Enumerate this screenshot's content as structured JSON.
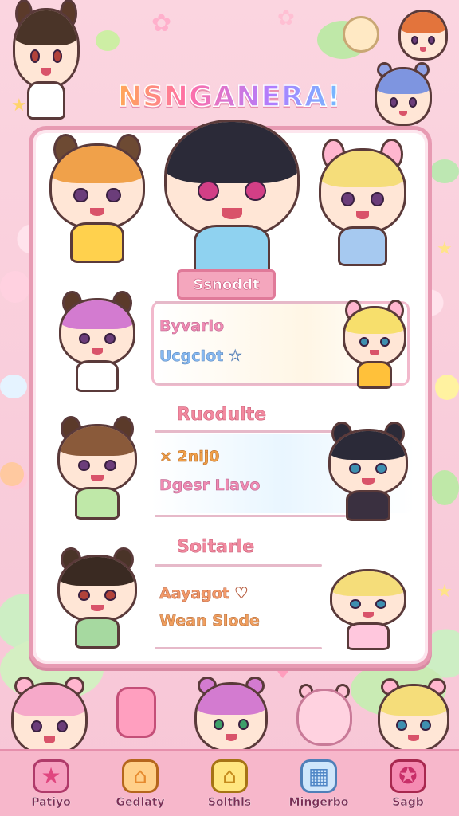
{
  "app": {
    "title": "NSNGANERA!"
  },
  "panel": {
    "feature_label": "Ssnoddt",
    "rows": [
      {
        "line1": "Byvarlo",
        "line2": "Ucgclot"
      },
      {
        "section": "Ruodulte",
        "line1": "× 2nij0",
        "line2": "Dgesr Llavo"
      },
      {
        "section": "Soitarle",
        "line1": "Aayagot",
        "line2": "Wean Slode"
      }
    ]
  },
  "nav": [
    {
      "label": "Patiyo",
      "icon": "star-icon",
      "color": "#f27aa8"
    },
    {
      "label": "Gedlaty",
      "icon": "house-icon",
      "color": "#ffb347"
    },
    {
      "label": "Solthls",
      "icon": "home-icon",
      "color": "#ffd24d"
    },
    {
      "label": "Mingerbo",
      "icon": "calendar-icon",
      "color": "#8fc6f0"
    },
    {
      "label": "Sagb",
      "icon": "star-badge-icon",
      "color": "#f06a9a"
    }
  ],
  "colors": {
    "background": "#fbd3df",
    "panel_border": "#e79ab2",
    "accent_pink": "#f08bb3",
    "accent_blue": "#86b8f0"
  }
}
